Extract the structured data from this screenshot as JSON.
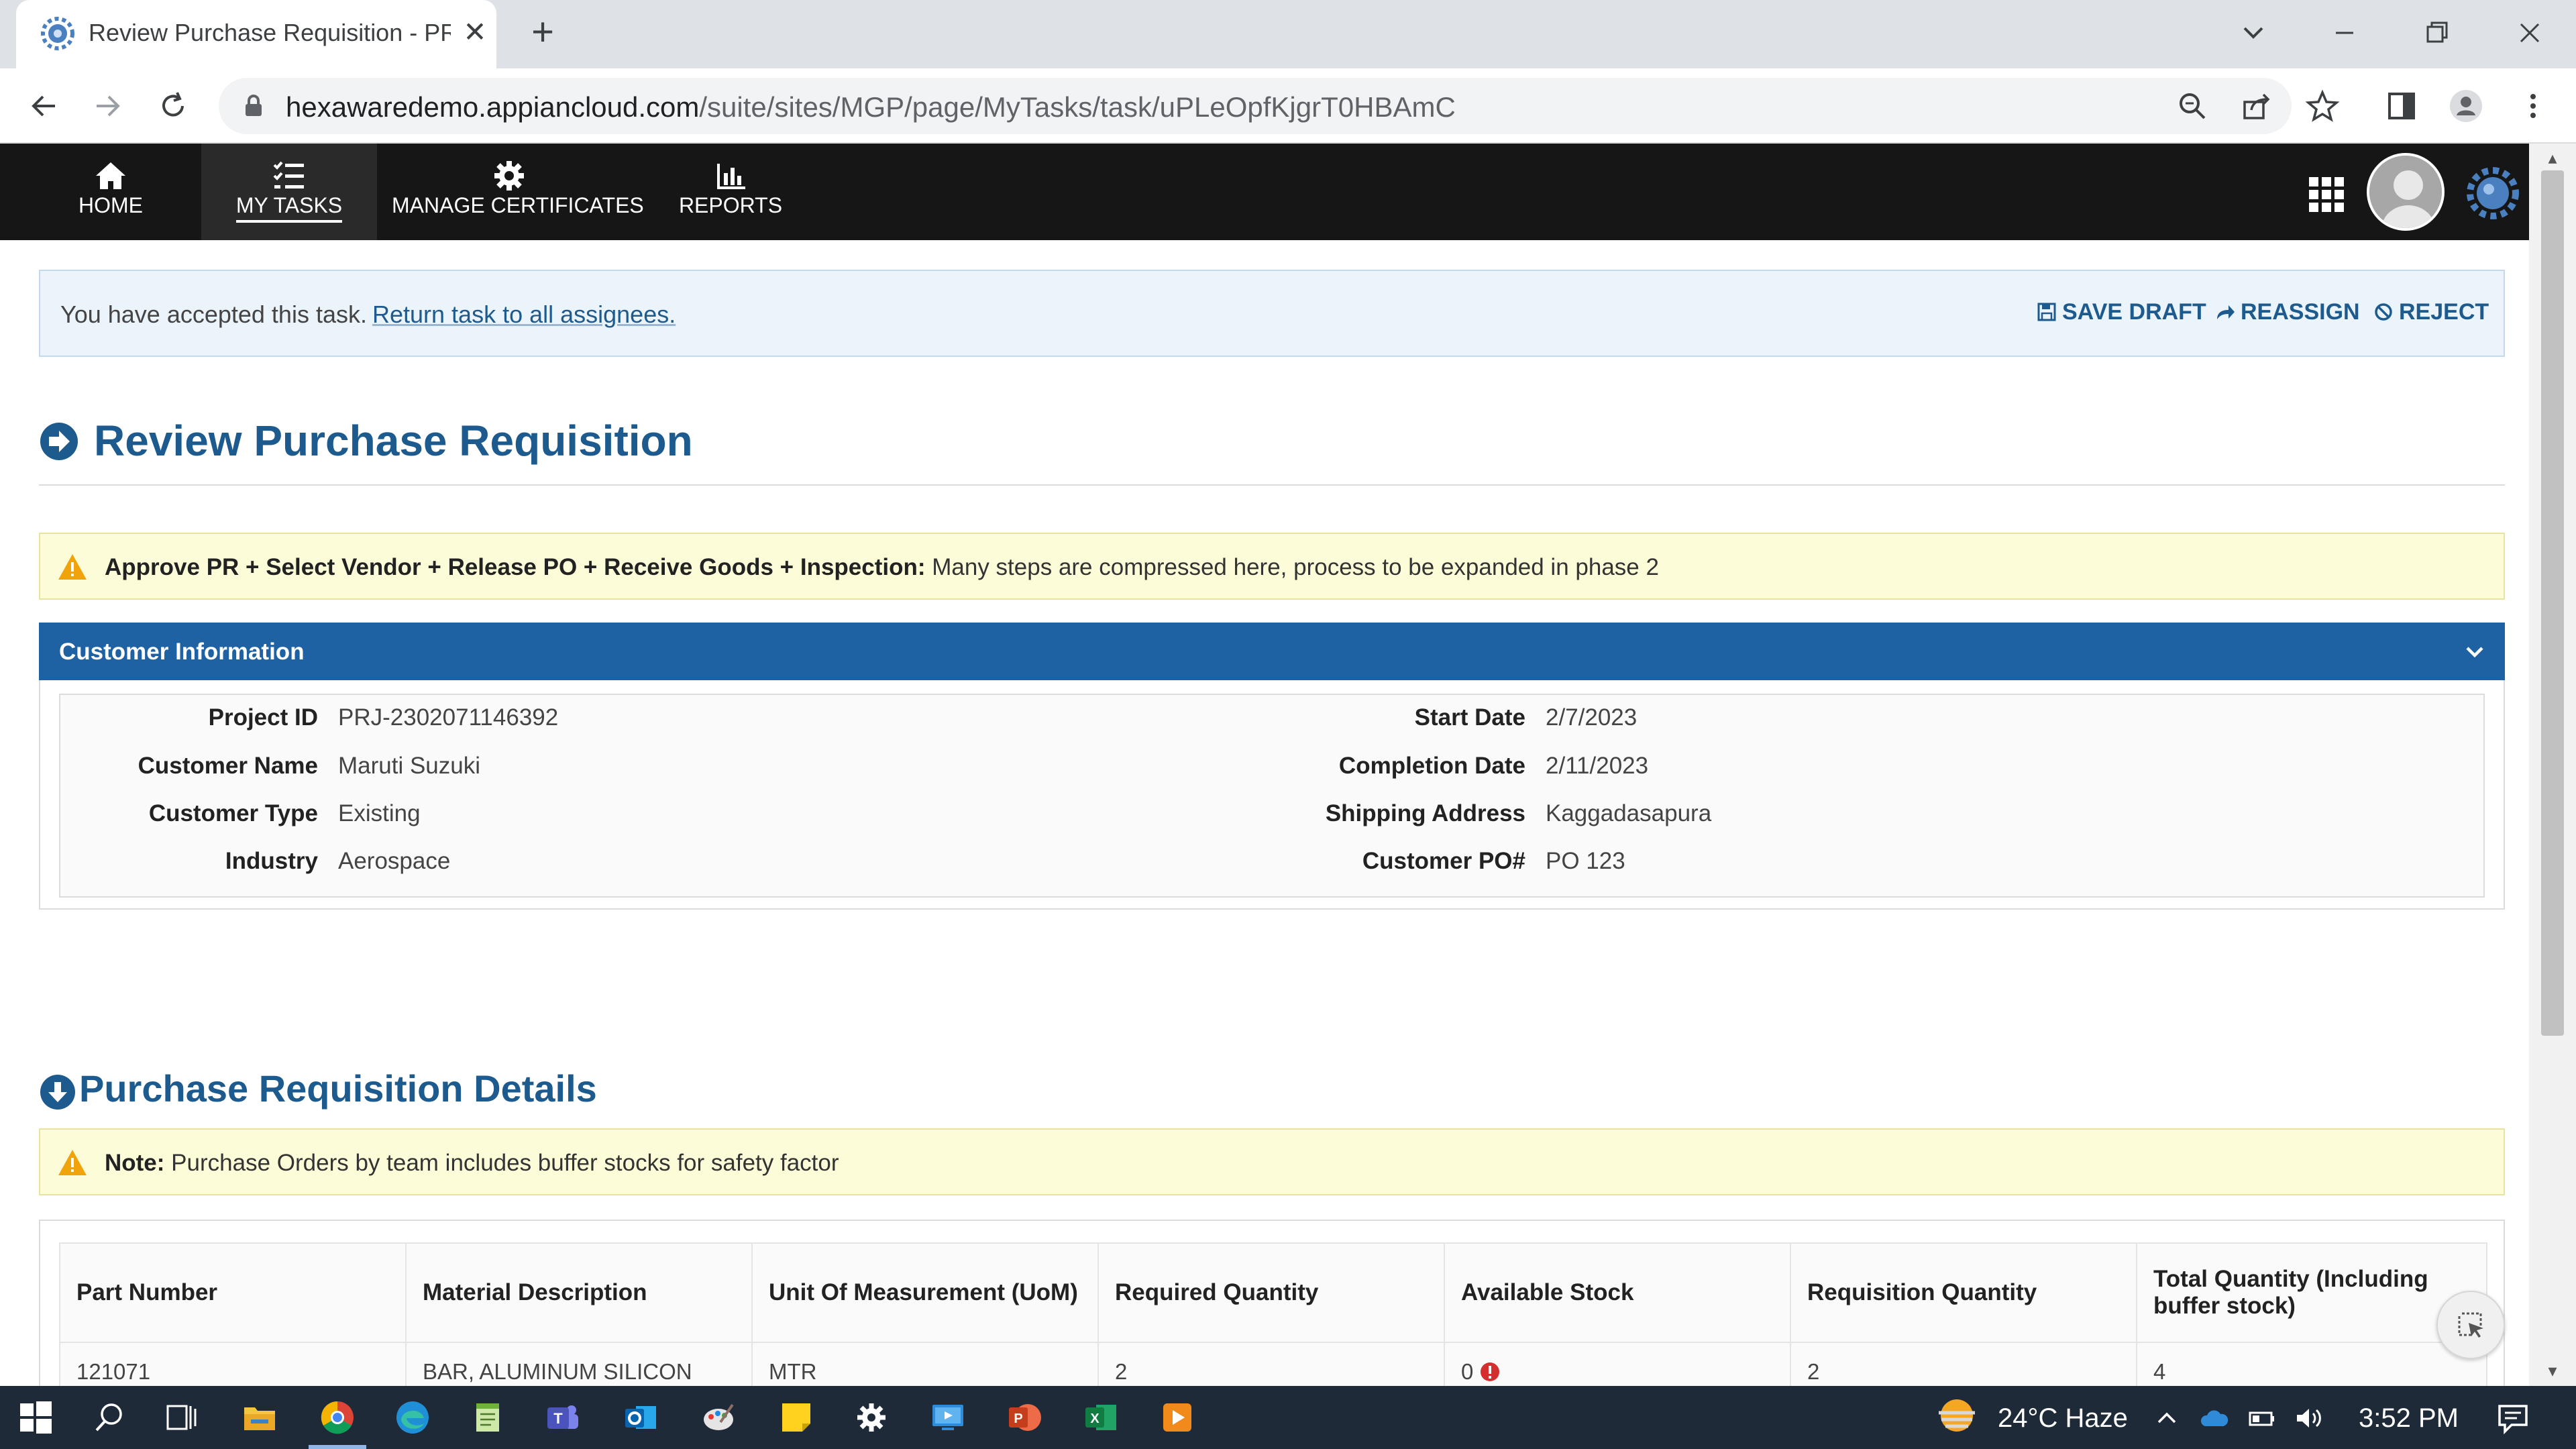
{
  "browser": {
    "tab_title": "Review Purchase Requisition - PR",
    "tab_close": "✕",
    "new_tab": "+",
    "url_host": "hexawaredemo.appiancloud.com",
    "url_path": "/suite/sites/MGP/page/MyTasks/task/uPLeOpfKjgrT0HBAmC"
  },
  "app_nav": {
    "items": [
      {
        "label": "HOME",
        "icon": "home-icon"
      },
      {
        "label": "MY TASKS",
        "icon": "tasks-icon",
        "active": true
      },
      {
        "label": "MANAGE CERTIFICATES",
        "icon": "gear-icon"
      },
      {
        "label": "REPORTS",
        "icon": "bar-chart-icon"
      }
    ]
  },
  "task_banner": {
    "message": "You have accepted this task.",
    "link": "Return task to all assignees.",
    "actions": {
      "save_draft": "SAVE DRAFT",
      "reassign": "REASSIGN",
      "reject": "REJECT"
    }
  },
  "page_title": "Review Purchase Requisition",
  "process_notice": {
    "bold": "Approve PR + Select Vendor + Release PO + Receive Goods + Inspection:",
    "text": "Many steps are compressed here, process to be expanded in phase 2"
  },
  "customer_section": {
    "title": "Customer Information",
    "left_fields": [
      {
        "label": "Project ID",
        "value": "PRJ-2302071146392"
      },
      {
        "label": "Customer Name",
        "value": "Maruti Suzuki"
      },
      {
        "label": "Customer Type",
        "value": "Existing"
      },
      {
        "label": "Industry",
        "value": "Aerospace"
      }
    ],
    "right_fields": [
      {
        "label": "Start Date",
        "value": "2/7/2023"
      },
      {
        "label": "Completion Date",
        "value": "2/11/2023"
      },
      {
        "label": "Shipping Address",
        "value": "Kaggadasapura"
      },
      {
        "label": "Customer PO#",
        "value": "PO 123"
      }
    ]
  },
  "pr_section": {
    "title": "Purchase Requisition Details",
    "note_bold": "Note:",
    "note_text": "Purchase Orders by team includes buffer stocks for safety factor"
  },
  "table": {
    "headers": [
      "Part Number",
      "Material Description",
      "Unit Of Measurement (UoM)",
      "Required Quantity",
      "Available Stock",
      "Requisition Quantity",
      "Total Quantity (Including buffer stock)"
    ],
    "rows": [
      [
        "121071",
        "BAR, ALUMINUM SILICON",
        "MTR",
        "2",
        "0",
        "2",
        "4"
      ]
    ]
  },
  "taskbar": {
    "weather": "24°C  Haze",
    "time": "3:52 PM"
  },
  "colors": {
    "accent_blue": "#1d5b8e",
    "section_header": "#1f62a3",
    "nav_bg": "#161616",
    "warning_bg": "#fdfcd9",
    "info_bg": "#ebf3fb",
    "error_red": "#d32f2f"
  }
}
